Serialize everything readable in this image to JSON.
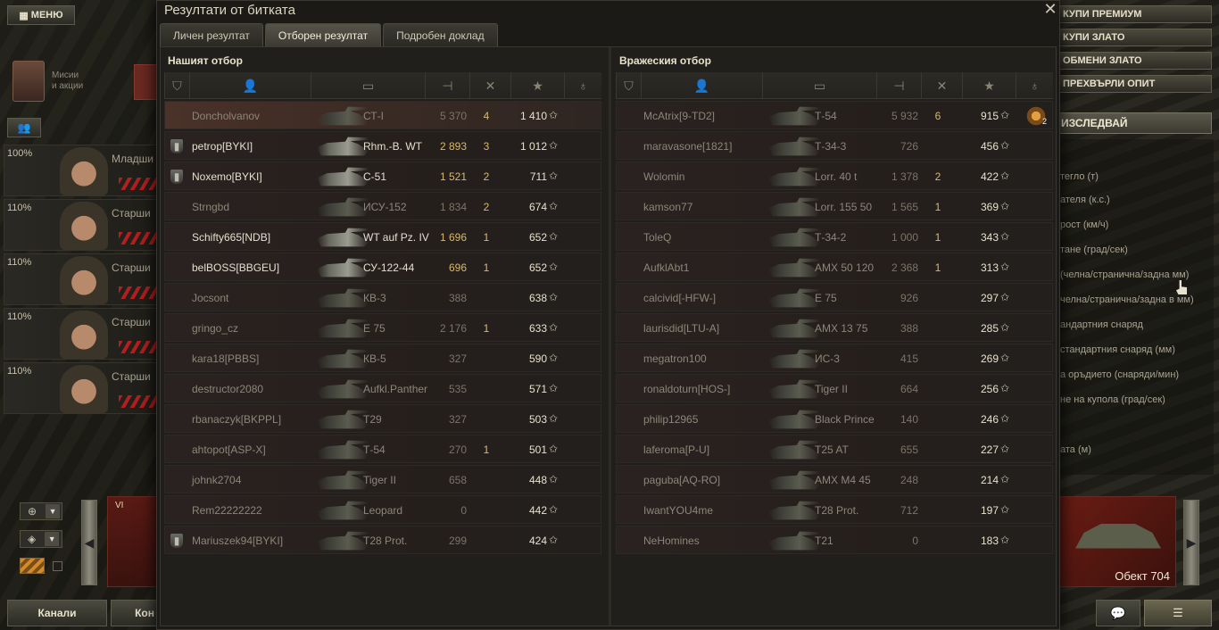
{
  "hangar": {
    "menu_label": "МЕНЮ",
    "missions_label": "Мисии\nи акции",
    "crew": [
      {
        "pct": "100%",
        "rank": "Младши"
      },
      {
        "pct": "110%",
        "rank": "Старши"
      },
      {
        "pct": "110%",
        "rank": "Старши"
      },
      {
        "pct": "110%",
        "rank": "Старши"
      },
      {
        "pct": "110%",
        "rank": "Старши"
      }
    ],
    "tank_card_left_tier": "VI",
    "bottom_buttons": [
      "Канали",
      "Кон"
    ],
    "right_buttons": [
      "КУПИ ПРЕМИУМ",
      "КУПИ ЗЛАТО",
      "ОБМЕНИ ЗЛАТО",
      "ПРЕХВЪРЛИ ОПИТ"
    ],
    "research_label": "ИЗСЛЕДВАЙ",
    "specs": [
      "тегло (т)",
      "ателя (к.с.)",
      "рост (км/ч)",
      "тане (град/сек)",
      "(челна/странична/задна мм)",
      "челна/странична/задна в мм)",
      "андартния снаряд",
      "стандартния снаряд (мм)",
      "а оръдието (снаряди/мин)",
      "не на купола (град/сек)",
      "ата (м)"
    ],
    "tank_card_right_name": "Обект 704"
  },
  "dialog": {
    "title": "Резултати от битката",
    "tabs": [
      "Личен резултат",
      "Отборен резултат",
      "Подробен доклад"
    ],
    "active_tab": 1,
    "teams": [
      {
        "title": "Нашият отбор",
        "rows": [
          {
            "player": "Doncholvanov",
            "vehicle": "СТ-I",
            "damage": "5 370",
            "kills": "4",
            "xp": "1 410",
            "alive": false,
            "platoon": false,
            "highlight": true
          },
          {
            "player": "petrop[BYKI]",
            "vehicle": "Rhm.-B. WT",
            "damage": "2 893",
            "kills": "3",
            "xp": "1 012",
            "alive": true,
            "platoon": true
          },
          {
            "player": "Noxemo[BYKI]",
            "vehicle": "С-51",
            "damage": "1 521",
            "kills": "2",
            "xp": "711",
            "alive": true,
            "platoon": true
          },
          {
            "player": "Strngbd",
            "vehicle": "ИСУ-152",
            "damage": "1 834",
            "kills": "2",
            "xp": "674",
            "alive": false,
            "platoon": false
          },
          {
            "player": "Schifty665[NDB]",
            "vehicle": "WT auf Pz. IV",
            "damage": "1 696",
            "kills": "1",
            "xp": "652",
            "alive": true,
            "platoon": false
          },
          {
            "player": "belBOSS[BBGEU]",
            "vehicle": "СУ-122-44",
            "damage": "696",
            "kills": "1",
            "xp": "652",
            "alive": true,
            "platoon": false
          },
          {
            "player": "Jocsont",
            "vehicle": "КВ-3",
            "damage": "388",
            "kills": "",
            "xp": "638",
            "alive": false,
            "platoon": false
          },
          {
            "player": "gringo_cz",
            "vehicle": "E 75",
            "damage": "2 176",
            "kills": "1",
            "xp": "633",
            "alive": false,
            "platoon": false
          },
          {
            "player": "kara18[PBBS]",
            "vehicle": "КВ-5",
            "damage": "327",
            "kills": "",
            "xp": "590",
            "alive": false,
            "platoon": false
          },
          {
            "player": "destructor2080",
            "vehicle": "Aufkl.Panther",
            "damage": "535",
            "kills": "",
            "xp": "571",
            "alive": false,
            "platoon": false
          },
          {
            "player": "rbanaczyk[BKPPL]",
            "vehicle": "T29",
            "damage": "327",
            "kills": "",
            "xp": "503",
            "alive": false,
            "platoon": false
          },
          {
            "player": "ahtopot[ASP-X]",
            "vehicle": "Т-54",
            "damage": "270",
            "kills": "1",
            "xp": "501",
            "alive": false,
            "platoon": false
          },
          {
            "player": "johnk2704",
            "vehicle": "Tiger II",
            "damage": "658",
            "kills": "",
            "xp": "448",
            "alive": false,
            "platoon": false
          },
          {
            "player": "Rem22222222",
            "vehicle": "Leopard",
            "damage": "0",
            "kills": "",
            "xp": "442",
            "alive": false,
            "platoon": false
          },
          {
            "player": "Mariuszek94[BYKI]",
            "vehicle": "T28 Prot.",
            "damage": "299",
            "kills": "",
            "xp": "424",
            "alive": false,
            "platoon": true
          }
        ]
      },
      {
        "title": "Вражеския отбор",
        "rows": [
          {
            "player": "McAtrix[9-TD2]",
            "vehicle": "Т-54",
            "damage": "5 932",
            "kills": "6",
            "xp": "915",
            "alive": false,
            "platoon": false,
            "medal": "2"
          },
          {
            "player": "maravasone[1821]",
            "vehicle": "Т-34-3",
            "damage": "726",
            "kills": "",
            "xp": "456",
            "alive": false,
            "platoon": false
          },
          {
            "player": "Wolomin",
            "vehicle": "Lorr. 40 t",
            "damage": "1 378",
            "kills": "2",
            "xp": "422",
            "alive": false,
            "platoon": false
          },
          {
            "player": "kamson77",
            "vehicle": "Lorr. 155 50",
            "damage": "1 565",
            "kills": "1",
            "xp": "369",
            "alive": false,
            "platoon": false
          },
          {
            "player": "ToleQ",
            "vehicle": "Т-34-2",
            "damage": "1 000",
            "kills": "1",
            "xp": "343",
            "alive": false,
            "platoon": false
          },
          {
            "player": "AufklAbt1",
            "vehicle": "AMX 50 120",
            "damage": "2 368",
            "kills": "1",
            "xp": "313",
            "alive": false,
            "platoon": false
          },
          {
            "player": "calcivid[-HFW-]",
            "vehicle": "E 75",
            "damage": "926",
            "kills": "",
            "xp": "297",
            "alive": false,
            "platoon": false
          },
          {
            "player": "laurisdid[LTU-A]",
            "vehicle": "AMX 13 75",
            "damage": "388",
            "kills": "",
            "xp": "285",
            "alive": false,
            "platoon": false
          },
          {
            "player": "megatron100",
            "vehicle": "ИС-3",
            "damage": "415",
            "kills": "",
            "xp": "269",
            "alive": false,
            "platoon": false
          },
          {
            "player": "ronaldoturn[HOS-]",
            "vehicle": "Tiger II",
            "damage": "664",
            "kills": "",
            "xp": "256",
            "alive": false,
            "platoon": false
          },
          {
            "player": "philip12965",
            "vehicle": "Black Prince",
            "damage": "140",
            "kills": "",
            "xp": "246",
            "alive": false,
            "platoon": false
          },
          {
            "player": "laferoma[P-U]",
            "vehicle": "T25 AT",
            "damage": "655",
            "kills": "",
            "xp": "227",
            "alive": false,
            "platoon": false
          },
          {
            "player": "paguba[AQ-RO]",
            "vehicle": "AMX M4 45",
            "damage": "248",
            "kills": "",
            "xp": "214",
            "alive": false,
            "platoon": false
          },
          {
            "player": "IwantYOU4me",
            "vehicle": "T28 Prot.",
            "damage": "712",
            "kills": "",
            "xp": "197",
            "alive": false,
            "platoon": false
          },
          {
            "player": "NeHomines",
            "vehicle": "T21",
            "damage": "0",
            "kills": "",
            "xp": "183",
            "alive": false,
            "platoon": false
          }
        ]
      }
    ]
  }
}
